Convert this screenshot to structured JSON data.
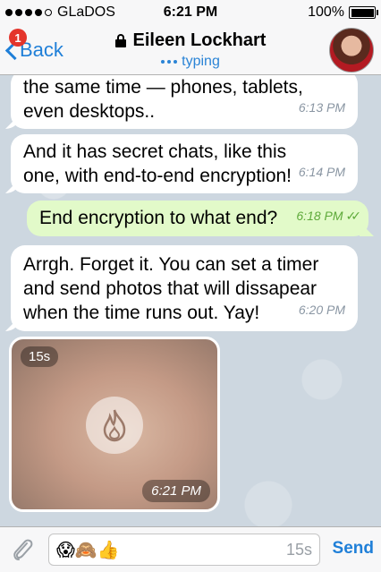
{
  "status_bar": {
    "carrier": "GLaDOS",
    "time": "6:21 PM",
    "battery": "100%"
  },
  "nav": {
    "back_label": "Back",
    "unread_count": "1",
    "title": "Eileen Lockhart",
    "subtitle": "typing"
  },
  "messages": [
    {
      "direction": "in",
      "text": "the same time — phones, tablets, even desktops..",
      "time": "6:13 PM"
    },
    {
      "direction": "in",
      "text": "And it has secret chats, like this one, with end-to-end encryption!",
      "time": "6:14 PM"
    },
    {
      "direction": "out",
      "text": "End encryption to what end?",
      "time": "6:18 PM"
    },
    {
      "direction": "in",
      "text": "Arrgh. Forget it. You can set a timer and send photos that will dissapear when the time runs out. Yay!",
      "time": "6:20 PM"
    }
  ],
  "photo": {
    "ttl": "15s",
    "time": "6:21 PM"
  },
  "composer": {
    "emojis": "😱🙈👍",
    "ttl_label": "15s",
    "send_label": "Send"
  },
  "colors": {
    "accent": "#1f7fd8",
    "outgoing_bubble": "#e2fac9",
    "badge": "#e4352c"
  }
}
